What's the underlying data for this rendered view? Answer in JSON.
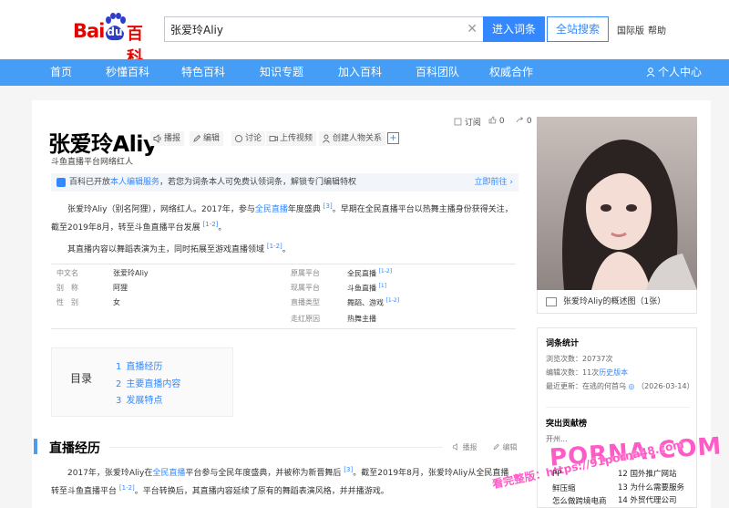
{
  "header": {
    "logo_left": "Bai",
    "logo_du": "du",
    "logo_right": "百科",
    "search_value": "张爱玲Aliy",
    "enter_label": "进入词条",
    "site_search_label": "全站搜索",
    "intl_label": "国际版",
    "help_label": "帮助"
  },
  "nav": {
    "items": [
      "首页",
      "秒懂百科",
      "特色百科",
      "知识专题",
      "加入百科",
      "百科团队",
      "权威合作"
    ],
    "user_label": "个人中心"
  },
  "entry": {
    "title": "张爱玲Aliy",
    "tools": [
      "播报",
      "编辑",
      "讨论",
      "上传视频",
      "创建人物关系"
    ],
    "plus": "+",
    "subscribe": "订阅",
    "like_count": "0",
    "share_count": "0",
    "subtitle": "斗鱼直播平台网络红人",
    "notice_prefix": "百科已开放",
    "notice_link": "本人编辑服务",
    "notice_suffix": "，若您为词条本人可免费认领词条，解锁专门编辑特权",
    "notice_action": "立即前往 ›",
    "para1_a": "张爱玲Aliy（别名阿狸），网络红人。2017年，参与",
    "para1_link": "全民直播",
    "para1_b": "年度盛典",
    "para1_ref1": "[3]",
    "para1_c": "。早期在全民直播平台以热舞主播身份获得关注，截至2019年8月，转至斗鱼直播平台发展",
    "para1_ref2": "[1-2]",
    "para1_d": "。",
    "para2_a": "其直播内容以舞蹈表演为主，同时拓展至游戏直播领域",
    "para2_ref": "[1-2]",
    "para2_b": "。"
  },
  "basic_info": {
    "left": [
      {
        "name": "中文名",
        "value": "张爱玲Aliy",
        "ref": ""
      },
      {
        "name": "别　称",
        "value": "阿狸",
        "ref": ""
      },
      {
        "name": "性　别",
        "value": "女",
        "ref": ""
      }
    ],
    "right": [
      {
        "name": "原属平台",
        "value": "全民直播",
        "ref": "[1-2]"
      },
      {
        "name": "现属平台",
        "value": "斗鱼直播",
        "ref": "[1]"
      },
      {
        "name": "直播类型",
        "value": "舞蹈、游戏",
        "ref": "[1-2]"
      },
      {
        "name": "走红原因",
        "value": "热舞主播",
        "ref": ""
      }
    ]
  },
  "catalog": {
    "label": "目录",
    "items": [
      {
        "num": "1",
        "text": "直播经历"
      },
      {
        "num": "2",
        "text": "主要直播内容"
      },
      {
        "num": "3",
        "text": "发展特点"
      }
    ]
  },
  "section": {
    "title": "直播经历",
    "edit1": "播报",
    "edit2": "编辑",
    "para_a": "2017年，张爱玲Aliy在",
    "para_link": "全民直播",
    "para_b": "平台参与全民年度盛典，并被称为新晋舞后",
    "para_ref1": "[3]",
    "para_c": "。截至2019年8月，张爱玲Aliy从全民直播转至斗鱼直播平台",
    "para_ref2": "[1-2]",
    "para_d": "。平台转换后，其直播内容延续了原有的舞蹈表演风格，并并播游戏。"
  },
  "sidebar": {
    "photo_caption": "张爱玲Aliy的概述图（1张）",
    "stats_title": "词条统计",
    "views_label": "浏览次数：",
    "views_value": "20737次",
    "edits_label": "编辑次数：",
    "edits_value": "11次",
    "edits_link": "历史版本",
    "recent_label": "最近更新：",
    "recent_value": "在逃的何首乌",
    "recent_date": "（2026-03-14）",
    "contrib_title": "突出贡献榜",
    "contrib_sub": "开州..."
  },
  "watermark": {
    "logo": "PORNA.COM",
    "url": "看完整版：https://91porna48.com",
    "ads": [
      "PP",
      "鲜压缩",
      "怎么做跨境电商",
      "12 国外推广网站",
      "13 为什么需要服务",
      "14 外贸代理公司"
    ]
  },
  "colors": {
    "brand_blue": "#3388ff",
    "nav_blue": "#459df5",
    "baidu_red": "#e10602",
    "watermark_pink": "#ff5bc8"
  }
}
